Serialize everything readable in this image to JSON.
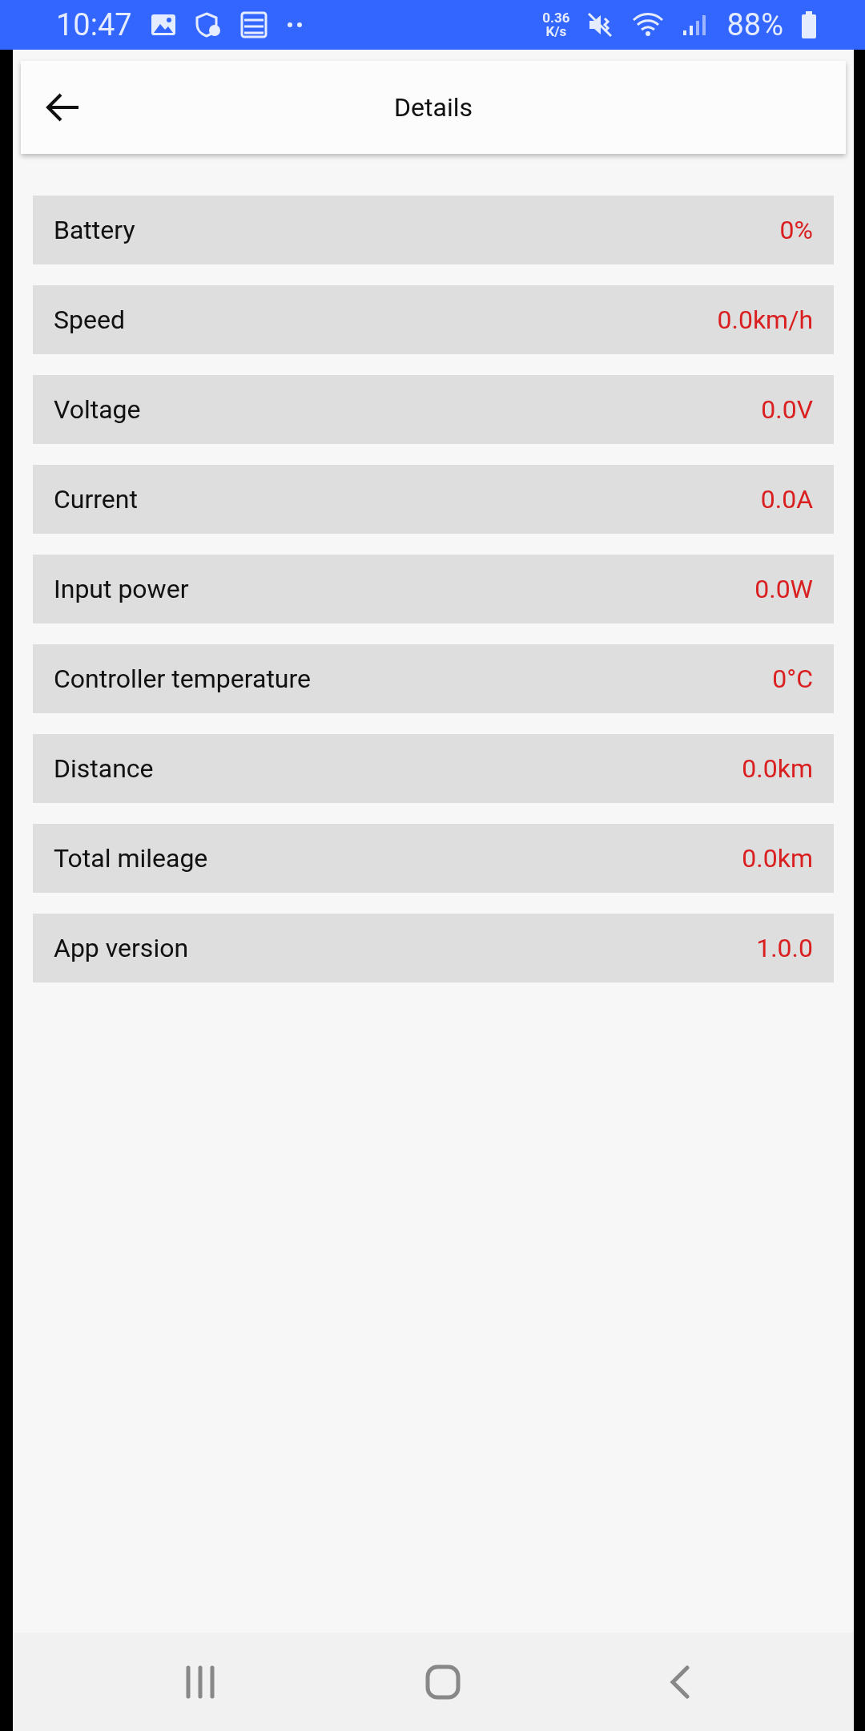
{
  "status_bar": {
    "time": "10:47",
    "net_speed_value": "0.36",
    "net_speed_unit": "K/s",
    "battery": "88%"
  },
  "header": {
    "title": "Details"
  },
  "rows": [
    {
      "label": "Battery",
      "value": "0%"
    },
    {
      "label": "Speed",
      "value": "0.0km/h"
    },
    {
      "label": "Voltage",
      "value": "0.0V"
    },
    {
      "label": "Current",
      "value": "0.0A"
    },
    {
      "label": "Input power",
      "value": "0.0W"
    },
    {
      "label": "Controller temperature",
      "value": "0°C"
    },
    {
      "label": "Distance",
      "value": "0.0km"
    },
    {
      "label": "Total mileage",
      "value": "0.0km"
    },
    {
      "label": "App version",
      "value": "1.0.0"
    }
  ]
}
